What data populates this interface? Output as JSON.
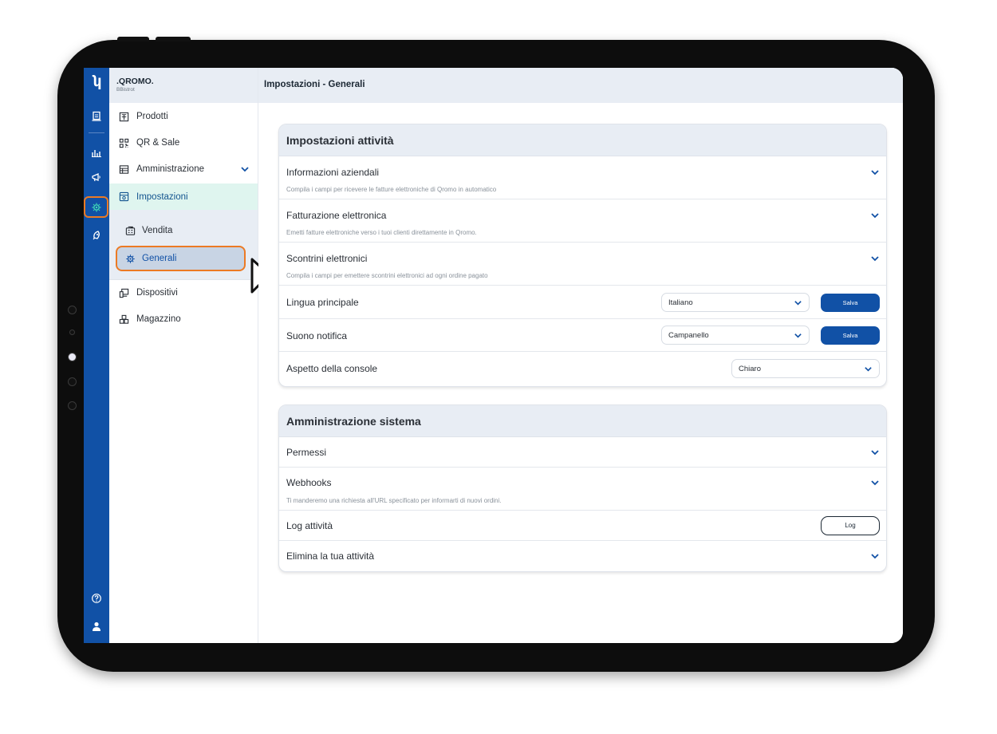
{
  "app": {
    "brand_name": ".QROMO.",
    "brand_sub": "BBistrot",
    "logo_glyph": "ʮ",
    "accent": "#1151a6",
    "highlight": "#ec7a24"
  },
  "rail": {
    "icons": [
      "receipt-icon",
      "bar-chart-icon",
      "megaphone-icon",
      "settings-gear-icon",
      "rocket-icon",
      "help-icon",
      "user-icon"
    ]
  },
  "sidebar": {
    "items": [
      {
        "label": "Prodotti",
        "icon": "menu-book-icon"
      },
      {
        "label": "QR & Sale",
        "icon": "qr-code-icon"
      },
      {
        "label": "Amministrazione",
        "icon": "admin-grid-icon"
      },
      {
        "label": "Impostazioni",
        "icon": "settings-panel-icon"
      }
    ],
    "sub_items": [
      {
        "label": "Vendita",
        "icon": "register-icon"
      },
      {
        "label": "Generali",
        "icon": "gear-icon"
      }
    ],
    "items_bottom": [
      {
        "label": "Dispositivi",
        "icon": "devices-icon"
      },
      {
        "label": "Magazzino",
        "icon": "warehouse-icon"
      }
    ]
  },
  "header": {
    "title": "Impostazioni - Generali"
  },
  "settings_card": {
    "title": "Impostazioni attività",
    "rows": [
      {
        "label": "Informazioni aziendali",
        "desc": "Compila i campi per ricevere le fatture elettroniche di Qromo in automatico"
      },
      {
        "label": "Fatturazione elettronica",
        "desc": "Emetti fatture elettroniche verso i tuoi clienti direttamente in Qromo."
      },
      {
        "label": "Scontrini elettronici",
        "desc": "Compila i campi per emettere scontrini elettronici ad ogni ordine pagato"
      },
      {
        "label": "Lingua principale",
        "value": "Italiano",
        "button": "Salva"
      },
      {
        "label": "Suono notifica",
        "value": "Campanello",
        "button": "Salva"
      },
      {
        "label": "Aspetto della console",
        "value": "Chiaro"
      }
    ]
  },
  "admin_card": {
    "title": "Amministrazione sistema",
    "rows": [
      {
        "label": "Permessi"
      },
      {
        "label": "Webhooks",
        "desc": "Ti manderemo una richiesta all'URL specificato per informarti di nuovi ordini."
      },
      {
        "label": "Log attività",
        "button": "Log"
      },
      {
        "label": "Elimina la tua attività"
      }
    ]
  }
}
